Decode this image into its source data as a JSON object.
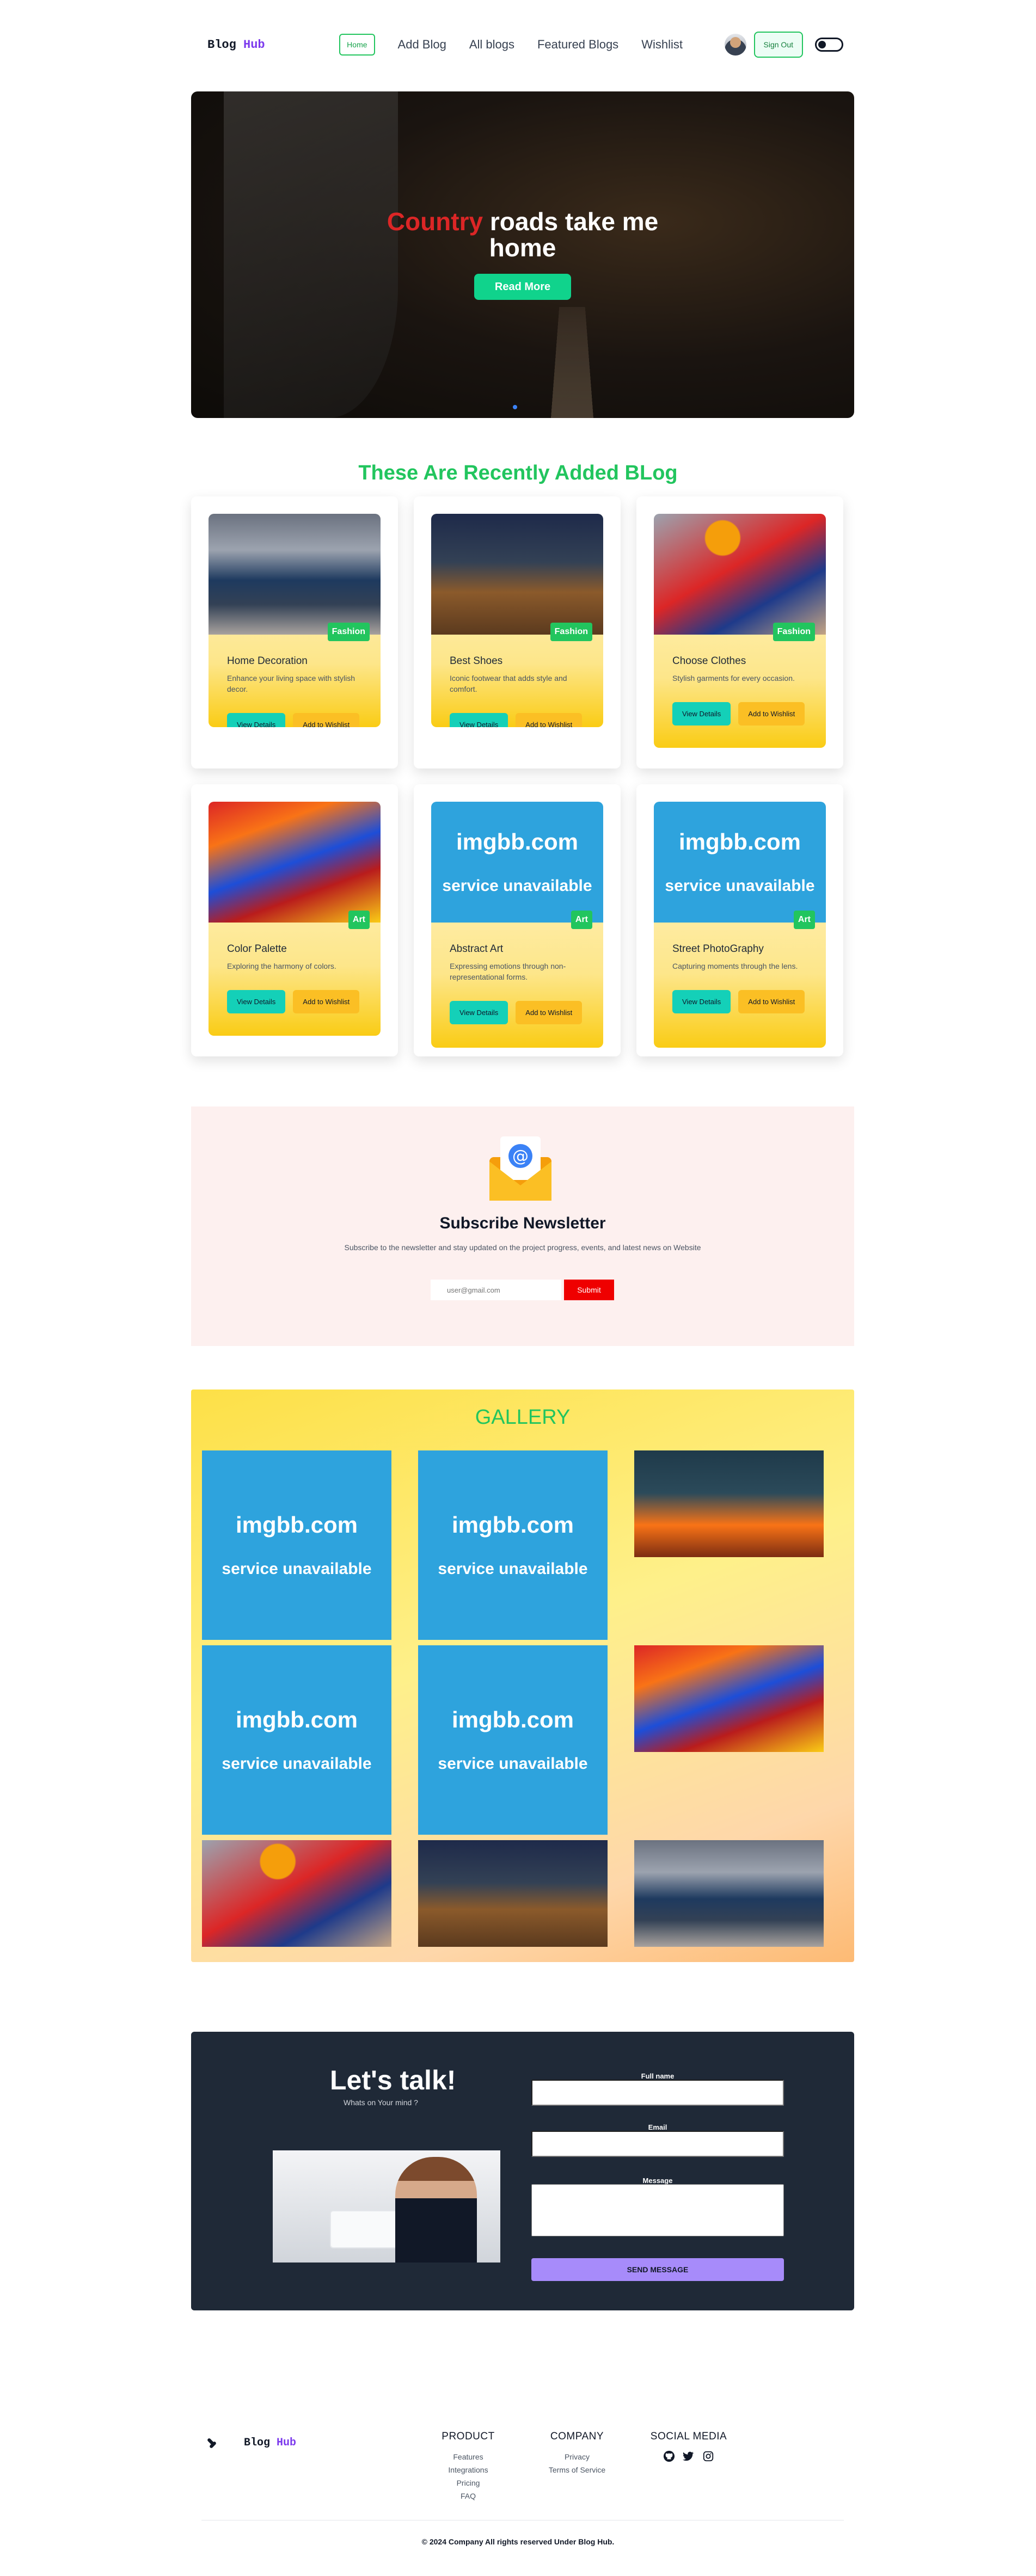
{
  "nav": {
    "logo_main": "Blog",
    "logo_accent": "Hub",
    "links": [
      "Home",
      "Add Blog",
      "All blogs",
      "Featured Blogs",
      "Wishlist"
    ],
    "signout_label": "Sign Out"
  },
  "hero": {
    "title_red": "Country",
    "title_rest_line1": " roads take me",
    "title_line2": "home",
    "button_label": "Read More"
  },
  "recent": {
    "title": "These Are Recently Added BLog",
    "view_label": "View Details",
    "wish_label": "Add to Wishlist",
    "cards": [
      {
        "title": "Home Decoration",
        "desc": "Enhance your living space with stylish decor.",
        "category": "Fashion",
        "image": "sofa-photo"
      },
      {
        "title": "Best Shoes",
        "desc": "Iconic footwear that adds style and comfort.",
        "category": "Fashion",
        "image": "shoes-photo"
      },
      {
        "title": "Choose Clothes",
        "desc": "Stylish garments for every occasion.",
        "category": "Fashion",
        "image": "clothes-photo"
      },
      {
        "title": "Color Palette",
        "desc": "Exploring the harmony of colors.",
        "category": "Art",
        "image": "palette-photo"
      },
      {
        "title": "Abstract Art",
        "desc": "Expressing emotions through non-representational forms.",
        "category": "Art",
        "image": "imgbb-placeholder"
      },
      {
        "title": "Street PhotoGraphy",
        "desc": "Capturing moments through the lens.",
        "category": "Art",
        "image": "imgbb-placeholder"
      }
    ]
  },
  "imgbb": {
    "line1": "imgbb.com",
    "line2": "service unavailable"
  },
  "newsletter": {
    "title": "Subscribe Newsletter",
    "desc": "Subscribe to the newsletter and stay updated on the project progress, events, and latest news on Website",
    "placeholder": "user@gmail.com",
    "submit_label": "Submit"
  },
  "gallery": {
    "title": "GALLERY"
  },
  "contact": {
    "title": "Let's talk!",
    "subtitle": "Whats on Your mind ?",
    "fullname_label": "Full name",
    "email_label": "Email",
    "message_label": "Message",
    "send_label": "SEND MESSAGE"
  },
  "footer": {
    "logo_main": "Blog",
    "logo_accent": "Hub",
    "product_title": "PRODUCT",
    "product_links": [
      "Features",
      "Integrations",
      "Pricing",
      "FAQ"
    ],
    "company_title": "COMPANY",
    "company_links": [
      "Privacy",
      "Terms of Service"
    ],
    "social_title": "SOCIAL MEDIA",
    "social_icons": [
      "github-icon",
      "twitter-icon",
      "instagram-icon"
    ],
    "copyright": "© 2024 Company All rights reserved Under Blog Hub."
  },
  "colors": {
    "accent_green": "#22c55e",
    "brand_purple": "#7c3aed",
    "hero_button": "#10d38c",
    "submit_red": "#ef0000",
    "contact_bg": "#1f2937"
  }
}
